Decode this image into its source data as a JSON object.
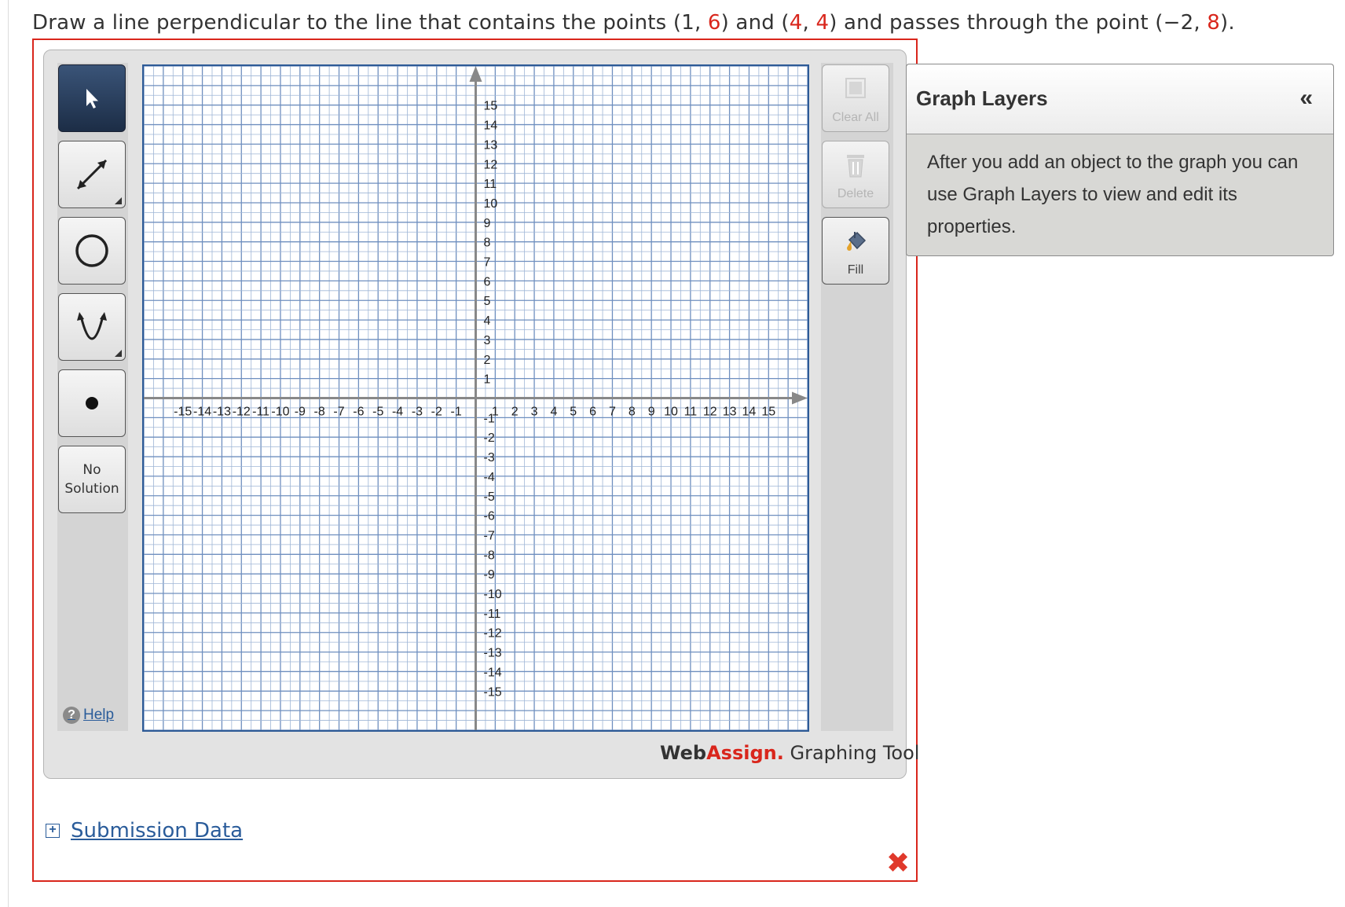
{
  "question": {
    "p1": "Draw a line perpendicular to the line that contains the points  (1, ",
    "v1": "6",
    "p2": ")  and  (",
    "v2": "4",
    "p3": ", ",
    "v3": "4",
    "p4": ")  and passes through the point  (−2, ",
    "v4": "8",
    "p5": ")."
  },
  "tools": {
    "no_solution_line1": "No",
    "no_solution_line2": "Solution",
    "help_label": "Help"
  },
  "side_buttons": {
    "clear_all": "Clear All",
    "delete": "Delete",
    "fill": "Fill"
  },
  "brand": {
    "web": "Web",
    "assign": "Assign.",
    "rest": " Graphing Tool"
  },
  "submission": {
    "label": "Submission Data"
  },
  "graph_layers": {
    "title": "Graph Layers",
    "collapse_glyph": "«",
    "body": "After you add an object to the graph you can use Graph Layers to view and edit its properties."
  },
  "graph": {
    "x_min": -17,
    "x_max": 17,
    "y_min": -17,
    "y_max": 17,
    "label_min": -15,
    "label_max": 15,
    "axis_color": "#888888",
    "grid_minor_color": "#9fb6d6",
    "grid_major_color": "#6f8fbf",
    "border_color": "#2d5a96"
  },
  "colors": {
    "accent": "#d9261c",
    "link": "#2a5c9a"
  }
}
